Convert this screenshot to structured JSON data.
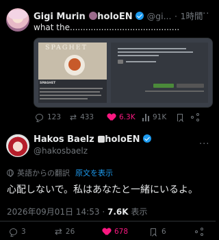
{
  "quoted_tweet": {
    "display_name": "Gigi Murin",
    "name_suffix": "holoEN",
    "handle": "@gi...",
    "separator": "·",
    "time": "1時間",
    "text": "what the..........................................",
    "media": {
      "title": "SPAGHET",
      "subtitle": "SPAGHET"
    },
    "metrics": {
      "replies": "123",
      "reposts": "433",
      "likes": "6.3K",
      "views": "91K"
    }
  },
  "reply_tweet": {
    "display_name": "Hakos Baelz",
    "name_suffix": "holoEN",
    "handle": "@hakosbaelz",
    "translated_from": "英語からの翻訳",
    "show_original": "原文を表示",
    "text": "心配しないで。私はあなたと一緒にいるよ。",
    "timestamp": "2026年09月01日 14:53",
    "dot": "·",
    "views_count": "7.6K",
    "views_label": "表示",
    "metrics": {
      "replies": "3",
      "reposts": "26",
      "likes": "678",
      "bookmarks": "6"
    }
  },
  "more_icon_text": "···",
  "colors": {
    "background": "#000000",
    "text": "#e7e9ea",
    "muted": "#71767b",
    "accent": "#1d9bf0",
    "like": "#f91880"
  }
}
